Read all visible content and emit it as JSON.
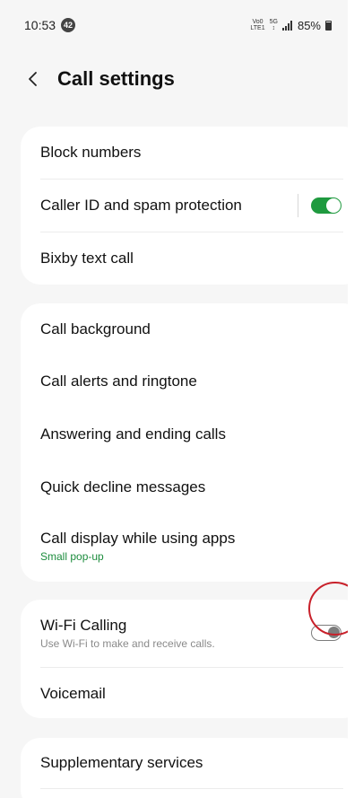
{
  "status_bar": {
    "time": "10:53",
    "notification_count": "42",
    "network_volte": "Vo0 LTE1",
    "network_5g": "5G",
    "battery": "85%"
  },
  "header": {
    "back_icon": "chevron-left-icon",
    "title": "Call settings"
  },
  "section1": {
    "block_numbers": "Block numbers",
    "caller_id": "Caller ID and spam protection",
    "caller_id_toggle": "on",
    "bixby": "Bixby text call"
  },
  "section2": {
    "call_background": "Call background",
    "call_alerts": "Call alerts and ringtone",
    "answering": "Answering and ending calls",
    "quick_decline": "Quick decline messages",
    "call_display": "Call display while using apps",
    "call_display_value": "Small pop-up"
  },
  "section3": {
    "wifi_calling": "Wi-Fi Calling",
    "wifi_calling_desc": "Use Wi-Fi to make and receive calls.",
    "wifi_calling_toggle": "off",
    "voicemail": "Voicemail"
  },
  "section4": {
    "supplementary": "Supplementary services"
  },
  "colors": {
    "accent_green": "#1f9a3f",
    "highlight_red": "#c8202a"
  }
}
